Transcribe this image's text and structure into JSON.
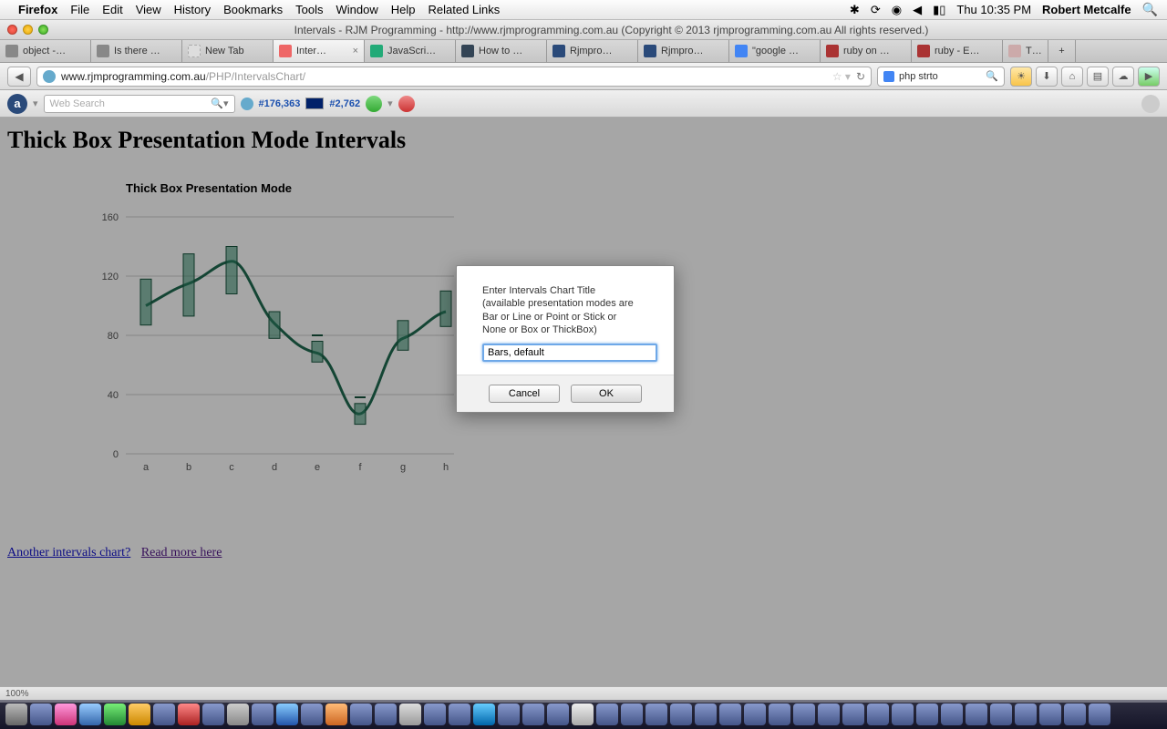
{
  "menubar": {
    "app": "Firefox",
    "items": [
      "File",
      "Edit",
      "View",
      "History",
      "Bookmarks",
      "Tools",
      "Window",
      "Help",
      "Related Links"
    ],
    "clock": "Thu 10:35 PM",
    "user": "Robert Metcalfe"
  },
  "window": {
    "title": "Intervals - RJM Programming - http://www.rjmprogramming.com.au (Copyright © 2013 rjmprogramming.com.au All rights reserved.)"
  },
  "tabs": [
    {
      "label": "object -…"
    },
    {
      "label": "Is there …"
    },
    {
      "label": "New Tab"
    },
    {
      "label": "Inter…",
      "active": true,
      "closeable": true
    },
    {
      "label": "JavaScri…"
    },
    {
      "label": "How to …"
    },
    {
      "label": "Rjmpro…"
    },
    {
      "label": "Rjmpro…"
    },
    {
      "label": "\"google …"
    },
    {
      "label": "ruby on …"
    },
    {
      "label": "ruby - E…"
    },
    {
      "label": "T…"
    }
  ],
  "url": {
    "host": "www.rjmprogramming.com.au",
    "path": "/PHP/IntervalsChart/"
  },
  "search": {
    "value": "php strto"
  },
  "alexa": {
    "placeholder": "Web Search",
    "rank_global": "#176,363",
    "rank_au": "#2,762"
  },
  "page": {
    "heading": "Thick Box Presentation Mode Intervals",
    "chart_title": "Thick Box Presentation Mode",
    "link1": "Another intervals chart?",
    "link2": "Read more here"
  },
  "prompt": {
    "line1": "Enter Intervals Chart Title",
    "line2": "(available presentation modes are",
    "line3": "Bar or Line or Point or Stick or",
    "line4": "None or Box or ThickBox)",
    "value": "Bars, default",
    "cancel": "Cancel",
    "ok": "OK"
  },
  "status": {
    "zoom": "100%"
  },
  "chart_data": {
    "type": "line",
    "title": "Thick Box Presentation Mode",
    "xlabel": "",
    "ylabel": "",
    "ylim": [
      0,
      160
    ],
    "yticks": [
      0,
      40,
      80,
      120,
      160
    ],
    "categories": [
      "a",
      "b",
      "c",
      "d",
      "e",
      "f",
      "g",
      "h"
    ],
    "values": [
      100,
      115,
      130,
      88,
      68,
      27,
      78,
      96
    ],
    "intervals": [
      {
        "low": 87,
        "high": 118
      },
      {
        "low": 93,
        "high": 135
      },
      {
        "low": 108,
        "high": 140
      },
      {
        "low": 78,
        "high": 96
      },
      {
        "low": 62,
        "high": 76
      },
      {
        "low": 20,
        "high": 34
      },
      {
        "low": 70,
        "high": 90
      },
      {
        "low": 86,
        "high": 110
      }
    ]
  }
}
